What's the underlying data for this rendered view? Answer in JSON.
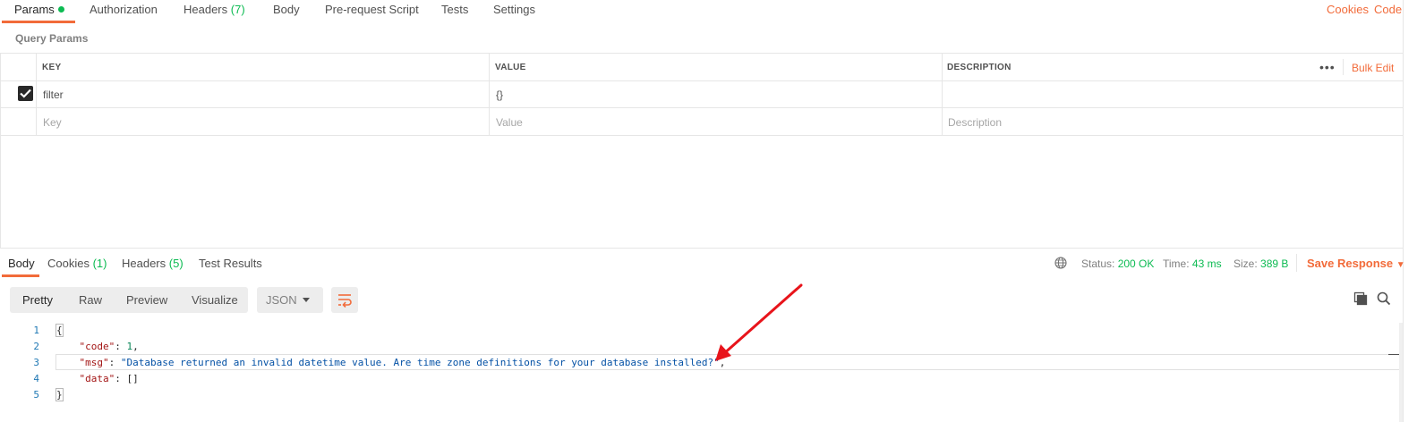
{
  "request_tabs": {
    "params": "Params",
    "authorization": "Authorization",
    "headers": "Headers",
    "headers_count": "(7)",
    "body": "Body",
    "prerequest": "Pre-request Script",
    "tests": "Tests",
    "settings": "Settings",
    "cookies": "Cookies",
    "code": "Code"
  },
  "query_params": {
    "title": "Query Params",
    "columns": {
      "key": "KEY",
      "value": "VALUE",
      "description": "DESCRIPTION"
    },
    "bulk_edit": "Bulk Edit",
    "rows": [
      {
        "checked": true,
        "key": "filter",
        "value": "{}",
        "description": ""
      }
    ],
    "placeholders": {
      "key": "Key",
      "value": "Value",
      "description": "Description"
    }
  },
  "response_tabs": {
    "body": "Body",
    "cookies": "Cookies",
    "cookies_count": "(1)",
    "headers": "Headers",
    "headers_count": "(5)",
    "test_results": "Test Results"
  },
  "response_status": {
    "status_label": "Status:",
    "status_value": "200 OK",
    "time_label": "Time:",
    "time_value": "43 ms",
    "size_label": "Size:",
    "size_value": "389 B",
    "save_response": "Save Response"
  },
  "format_toolbar": {
    "pretty": "Pretty",
    "raw": "Raw",
    "preview": "Preview",
    "visualize": "Visualize",
    "format": "JSON"
  },
  "code": {
    "line_numbers": [
      "1",
      "2",
      "3",
      "4",
      "5"
    ],
    "open_brace": "{",
    "code_key": "\"code\"",
    "code_value": "1",
    "msg_key": "\"msg\"",
    "msg_value": "\"Database returned an invalid datetime value. Are time zone definitions for your database installed?\"",
    "data_key": "\"data\"",
    "data_value": "[]",
    "close_brace": "}"
  },
  "colors": {
    "accent": "#f26b3a",
    "success": "#0cbb52",
    "annotation_arrow": "#e8141b"
  }
}
